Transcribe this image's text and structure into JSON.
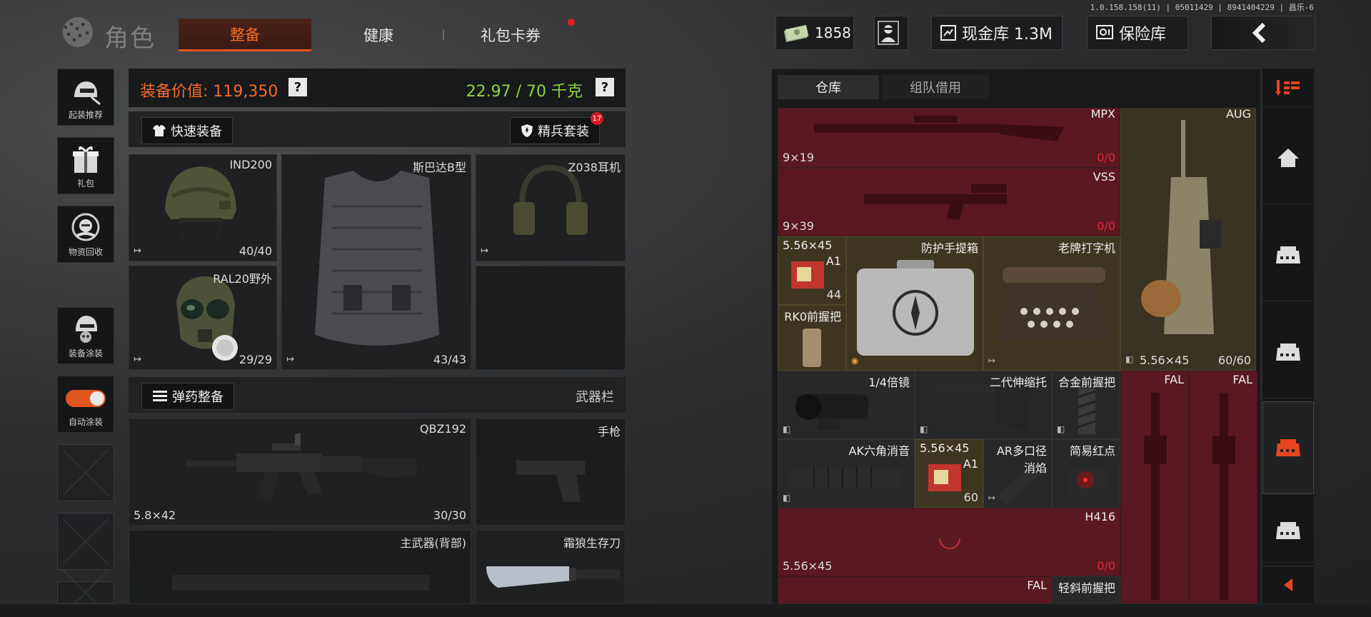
{
  "version": "1.0.158.158(11) | 05011429 | 8941404229 | 昌乐-6",
  "header": {
    "title": "角色",
    "tabs": [
      {
        "label": "整备",
        "active": true
      },
      {
        "label": "健康",
        "active": false
      },
      {
        "label": "礼包卡券",
        "active": false
      }
    ],
    "cash": "1858",
    "vault_label": "现金库 1.3M",
    "safe_label": "保险库"
  },
  "sidebar": [
    {
      "label": "起装推荐",
      "icon": "helmet-loadout-icon"
    },
    {
      "label": "礼包",
      "icon": "gift-icon"
    },
    {
      "label": "物资回收",
      "icon": "recycle-icon"
    },
    {
      "label": "装备涂装",
      "icon": "paint-icon"
    },
    {
      "label": "自动涂装",
      "icon": "toggle-switch"
    }
  ],
  "equipment": {
    "value_label": "装备价值: 119,350",
    "weight_label": "22.97 / 70 千克",
    "quick_equip": "快速装备",
    "elite_set": "精兵套装",
    "elite_badge": "17",
    "ammo_equip": "弹药整备",
    "weapon_bar": "武器栏",
    "slots": {
      "helmet": {
        "name": "IND200",
        "durability": "40/40"
      },
      "mask": {
        "name": "RAL20野外",
        "durability": "29/29"
      },
      "armor": {
        "name": "斯巴达B型",
        "durability": "43/43"
      },
      "headset": {
        "name": "Z038耳机"
      },
      "rifle": {
        "name": "QBZ192",
        "caliber": "5.8×42",
        "ammo": "30/30"
      },
      "pistol": {
        "name": "手枪"
      },
      "back_weapon": {
        "name": "主武器(背部)"
      },
      "knife": {
        "name": "霜狼生存刀"
      }
    }
  },
  "storage": {
    "tabs": [
      "仓库",
      "组队借用"
    ],
    "items": {
      "mpx": {
        "name": "MPX",
        "caliber": "9×19",
        "count": "0/0"
      },
      "vss": {
        "name": "VSS",
        "caliber": "9×39",
        "count": "0/0"
      },
      "aug": {
        "name": "AUG",
        "caliber": "5.56×45",
        "count": "60/60"
      },
      "ammo1": {
        "caliber": "5.56×45",
        "grade": "A1",
        "count": "44"
      },
      "case": {
        "name": "防护手提箱"
      },
      "typewriter": {
        "name": "老牌打字机"
      },
      "rk0": {
        "name": "RK0前握把"
      },
      "scope": {
        "name": "1/4倍镜"
      },
      "stock": {
        "name": "二代伸缩托"
      },
      "alloy_grip": {
        "name": "合金前握把"
      },
      "fal1": {
        "name": "FAL"
      },
      "fal2": {
        "name": "FAL"
      },
      "ak_suppressor": {
        "name": "AK六角消音"
      },
      "ammo2": {
        "caliber": "5.56×45",
        "grade": "A1",
        "count": "60"
      },
      "ar_brake": {
        "name": "AR多口径消焰"
      },
      "red_dot": {
        "name": "简易红点"
      },
      "h416": {
        "name": "H416",
        "caliber": "5.56×45",
        "count": "0/0"
      },
      "fal3": {
        "name": "FAL"
      },
      "angled_grip": {
        "name": "轻斜前握把"
      }
    }
  },
  "colors": {
    "accent": "#e2531d",
    "weight_ok": "#8fd43e",
    "danger": "#e02a3a"
  }
}
